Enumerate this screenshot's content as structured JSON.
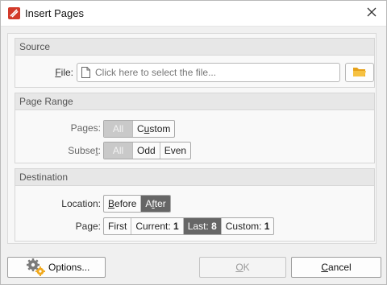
{
  "window": {
    "title": "Insert Pages",
    "app_icon": "pdf-app-icon",
    "close_icon": "close-icon"
  },
  "source": {
    "header": "Source",
    "file_label": "File:",
    "file_placeholder": "Click here to select the file...",
    "browse_icon": "folder-icon"
  },
  "page_range": {
    "header": "Page Range",
    "pages_label": "Pages:",
    "pages_options": [
      "All",
      "Custom"
    ],
    "subset_label": "Subset:",
    "subset_options": [
      "All",
      "Odd",
      "Even"
    ]
  },
  "destination": {
    "header": "Destination",
    "location_label": "Location:",
    "location_options": [
      "Before",
      "After"
    ],
    "page_label": "Page:",
    "page_options": {
      "first": "First",
      "current_label": "Current:",
      "current_value": "1",
      "last_label": "Last:",
      "last_value": "8",
      "custom_label": "Custom:",
      "custom_value": "1"
    }
  },
  "footer": {
    "options_label": "Options...",
    "options_icon": "gears-icon",
    "ok_label": "OK",
    "cancel_label": "Cancel"
  },
  "colors": {
    "active_segment": "#666666",
    "disabled_segment": "#c9c9c9",
    "folder": "#f2b01e",
    "app_icon": "#d23a2a"
  }
}
